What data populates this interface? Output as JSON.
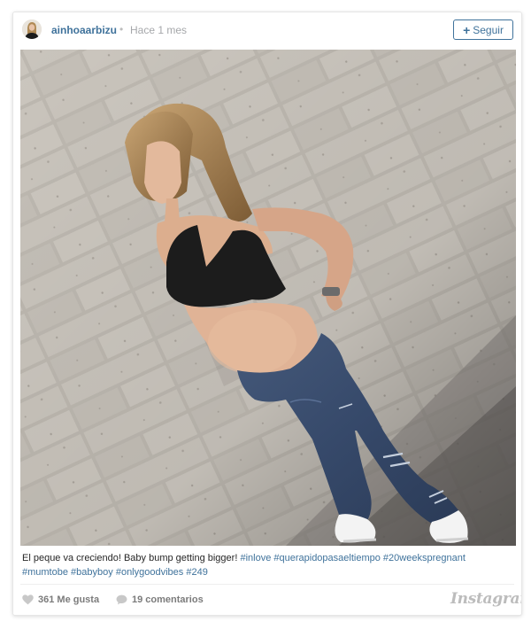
{
  "post": {
    "username": "ainhoaarbizu",
    "separator": "•",
    "time": "Hace 1 mes",
    "follow_label": "Seguir",
    "caption": {
      "text": "El peque va creciendo! Baby bump getting bigger!",
      "hashtags": [
        "#inlove",
        "#querapidopasaeltiempo",
        "#20weekspregnant",
        "#mumtobe",
        "#babyboy",
        "#onlygoodvibes",
        "#249"
      ]
    },
    "likes": "361 Me gusta",
    "comments": "19 comentarios",
    "brand": "Instagram"
  },
  "icons": {
    "avatar": "profile-photo",
    "follow": "plus-icon",
    "likes": "heart-icon",
    "comments": "speech-bubble-icon"
  },
  "colors": {
    "accent": "#3f729b",
    "muted": "#a5a7aa",
    "icon_gray": "#c8c8c8"
  }
}
